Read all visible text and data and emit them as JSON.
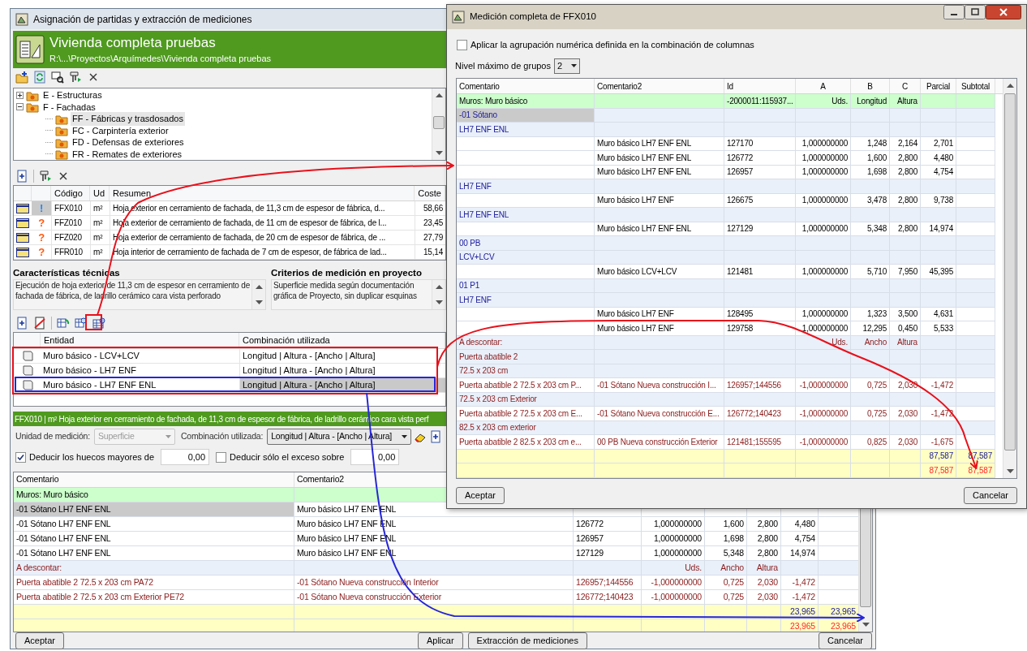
{
  "main_window": {
    "title": "Asignación de partidas y extracción de mediciones",
    "project": {
      "name": "Vivienda completa pruebas",
      "path": "R:\\...\\Proyectos\\Arquímedes\\Vivienda completa pruebas"
    },
    "tree": [
      {
        "label": "E - Estructuras",
        "expanded": false,
        "selected": false
      },
      {
        "label": "F - Fachadas",
        "expanded": true,
        "selected": false,
        "children": [
          {
            "label": "FF - Fábricas y trasdosados",
            "selected": true
          },
          {
            "label": "FC - Carpintería exterior",
            "selected": false
          },
          {
            "label": "FD - Defensas de exteriores",
            "selected": false
          },
          {
            "label": "FR - Remates de exteriores",
            "selected": false
          }
        ]
      }
    ],
    "items_table": {
      "columns": [
        "Código",
        "Ud",
        "Resumen",
        "Coste"
      ],
      "rows": [
        {
          "kind": "info",
          "mark": "!",
          "code": "FFX010",
          "unit": "m²",
          "summary": "Hoja exterior en cerramiento de fachada, de 11,3 cm de espesor de fábrica, d...",
          "cost": "58,66",
          "selected": true
        },
        {
          "kind": "unknown",
          "mark": "?",
          "code": "FFZ010",
          "unit": "m²",
          "summary": "Hoja exterior de cerramiento de fachada, de 11 cm de espesor de fábrica, de l...",
          "cost": "23,45",
          "selected": false
        },
        {
          "kind": "unknown",
          "mark": "?",
          "code": "FFZ020",
          "unit": "m²",
          "summary": "Hoja exterior de cerramiento de fachada, de 20 cm de espesor de fábrica, de ...",
          "cost": "27,79",
          "selected": false
        },
        {
          "kind": "unknown",
          "mark": "?",
          "code": "FFR010",
          "unit": "m²",
          "summary": "Hoja interior de cerramiento de fachada de 7 cm de espesor, de fábrica de lad...",
          "cost": "15,14",
          "selected": false
        }
      ]
    },
    "characteristics": {
      "title": "Características técnicas",
      "text": "Ejecución de hoja exterior de 11,3 cm de espesor en cerramiento de fachada de fábrica, de ladrillo cerámico cara vista perforado"
    },
    "criteria": {
      "title": "Criterios de medición en proyecto",
      "text": "Superficie medida según documentación gráfica de Proyecto, sin duplicar esquinas"
    },
    "entities_table": {
      "columns": [
        "Entidad",
        "Combinación utilizada"
      ],
      "rows": [
        {
          "entity": "Muro básico - LCV+LCV",
          "combination": "Longitud | Altura - [Ancho | Altura]",
          "selected": false
        },
        {
          "entity": "Muro básico - LH7 ENF",
          "combination": "Longitud | Altura - [Ancho | Altura]",
          "selected": false
        },
        {
          "entity": "Muro básico - LH7 ENF ENL",
          "combination": "Longitud | Altura - [Ancho | Altura]",
          "selected": true
        }
      ]
    },
    "item_bar": "FFX010 | m² Hoja exterior en cerramiento de fachada, de 11,3 cm de espesor de fábrica, de ladrillo cerámico cara vista perf",
    "unit": {
      "label": "Unidad de medición:",
      "value": "Superficie",
      "disabled": true
    },
    "combination": {
      "label": "Combinación utilizada:",
      "value": "Longitud | Altura - [Ancho | Altura]"
    },
    "deductions": [
      {
        "label": "Deducir los huecos mayores de",
        "checked": true,
        "value": "0,00"
      },
      {
        "label": "Deducir sólo el exceso sobre",
        "checked": false,
        "value": "0,00"
      }
    ],
    "measure_table": {
      "columns": [
        "Comentario",
        "Comentario2"
      ],
      "rows": [
        {
          "kind": "header",
          "selected": false,
          "comentario": "Muros: Muro básico"
        },
        {
          "kind": "item",
          "selected": true,
          "comentario": "-01 Sótano LH7 ENF ENL",
          "comentario2": "Muro básico LH7 ENF ENL"
        },
        {
          "kind": "item",
          "selected": false,
          "comentario": "-01 Sótano LH7 ENF ENL",
          "comentario2": "Muro básico LH7 ENF ENL",
          "id": "126772",
          "a": "1,000000000",
          "b": "1,600",
          "c": "2,800",
          "parcial": "4,480"
        },
        {
          "kind": "item",
          "selected": false,
          "comentario": "-01 Sótano LH7 ENF ENL",
          "comentario2": "Muro básico LH7 ENF ENL",
          "id": "126957",
          "a": "1,000000000",
          "b": "1,698",
          "c": "2,800",
          "parcial": "4,754"
        },
        {
          "kind": "item",
          "selected": false,
          "comentario": "-01 Sótano LH7 ENF ENL",
          "comentario2": "Muro básico LH7 ENF ENL",
          "id": "127129",
          "a": "1,000000000",
          "b": "5,348",
          "c": "2,800",
          "parcial": "14,974"
        },
        {
          "kind": "deduct-header",
          "selected": false,
          "comentario": "A descontar:",
          "a": "Uds.",
          "b": "Ancho",
          "c": "Altura"
        },
        {
          "kind": "deduct-item",
          "selected": false,
          "comentario": "Puerta abatible 2 72.5 x 203 cm PA72",
          "comentario2": "-01 Sótano Nueva construcción Interior",
          "id": "126957;144556",
          "a": "-1,000000000",
          "b": "0,725",
          "c": "2,030",
          "parcial": "-1,472"
        },
        {
          "kind": "deduct-item",
          "selected": false,
          "comentario": "Puerta abatible 2 72.5 x 203 cm Exterior PE72",
          "comentario2": "-01 Sótano Nueva construcción Exterior",
          "id": "126772;140423",
          "a": "-1,000000000",
          "b": "0,725",
          "c": "2,030",
          "parcial": "-1,472"
        },
        {
          "kind": "total",
          "selected": false,
          "parcial": "23,965",
          "subtotal": "23,965"
        },
        {
          "kind": "total-final",
          "selected": false,
          "parcial": "23,965",
          "subtotal": "23,965"
        }
      ]
    },
    "buttons": [
      "Aceptar",
      "Aplicar",
      "Extracción de mediciones",
      "Cancelar"
    ]
  },
  "dialog": {
    "title": "Medición completa de FFX010",
    "apply_grouping": {
      "label": "Aplicar la agrupación numérica definida en la combinación de columnas",
      "checked": false
    },
    "max_level": {
      "label": "Nivel máximo de grupos",
      "value": "2"
    },
    "table": {
      "columns": [
        "Comentario",
        "Comentario2",
        "Id",
        "A",
        "B",
        "C",
        "Parcial",
        "Subtotal"
      ],
      "rows": [
        {
          "kind": "header",
          "selected": false,
          "comentario": "Muros: Muro básico",
          "id": "-2000011:115937...",
          "a": "Uds.",
          "b": "Longitud",
          "c": "Altura"
        },
        {
          "kind": "group",
          "selected": true,
          "comentario": "-01 Sótano"
        },
        {
          "kind": "group",
          "selected": false,
          "comentario": "LH7 ENF ENL"
        },
        {
          "kind": "item",
          "selected": false,
          "comentario2": "Muro básico LH7 ENF ENL",
          "id": "127170",
          "a": "1,000000000",
          "b": "1,248",
          "c": "2,164",
          "parcial": "2,701"
        },
        {
          "kind": "item",
          "selected": false,
          "comentario2": "Muro básico LH7 ENF ENL",
          "id": "126772",
          "a": "1,000000000",
          "b": "1,600",
          "c": "2,800",
          "parcial": "4,480"
        },
        {
          "kind": "item",
          "selected": false,
          "comentario2": "Muro básico LH7 ENF ENL",
          "id": "126957",
          "a": "1,000000000",
          "b": "1,698",
          "c": "2,800",
          "parcial": "4,754"
        },
        {
          "kind": "group",
          "selected": false,
          "comentario": "LH7 ENF"
        },
        {
          "kind": "item",
          "selected": false,
          "comentario2": "Muro básico LH7 ENF",
          "id": "126675",
          "a": "1,000000000",
          "b": "3,478",
          "c": "2,800",
          "parcial": "9,738"
        },
        {
          "kind": "group",
          "selected": false,
          "comentario": "LH7 ENF ENL"
        },
        {
          "kind": "item",
          "selected": false,
          "comentario2": "Muro básico LH7 ENF ENL",
          "id": "127129",
          "a": "1,000000000",
          "b": "5,348",
          "c": "2,800",
          "parcial": "14,974"
        },
        {
          "kind": "group",
          "selected": false,
          "comentario": "00 PB"
        },
        {
          "kind": "group",
          "selected": false,
          "comentario": "LCV+LCV"
        },
        {
          "kind": "item",
          "selected": false,
          "comentario2": "Muro básico LCV+LCV",
          "id": "121481",
          "a": "1,000000000",
          "b": "5,710",
          "c": "7,950",
          "parcial": "45,395"
        },
        {
          "kind": "group",
          "selected": false,
          "comentario": "01 P1"
        },
        {
          "kind": "group",
          "selected": false,
          "comentario": "LH7 ENF"
        },
        {
          "kind": "item",
          "selected": false,
          "comentario2": "Muro básico LH7 ENF",
          "id": "128495",
          "a": "1,000000000",
          "b": "1,323",
          "c": "3,500",
          "parcial": "4,631"
        },
        {
          "kind": "item",
          "selected": false,
          "comentario2": "Muro básico LH7 ENF",
          "id": "129758",
          "a": "1,000000000",
          "b": "12,295",
          "c": "0,450",
          "parcial": "5,533"
        },
        {
          "kind": "deduct-header",
          "selected": false,
          "comentario": "A descontar:",
          "a": "Uds.",
          "b": "Ancho",
          "c": "Altura"
        },
        {
          "kind": "deduct-group",
          "selected": false,
          "comentario": "Puerta abatible 2"
        },
        {
          "kind": "deduct-group",
          "selected": false,
          "comentario": "72.5 x 203 cm"
        },
        {
          "kind": "deduct-item",
          "selected": false,
          "comentario": "Puerta abatible 2 72.5 x 203 cm P...",
          "comentario2": "-01 Sótano Nueva construcción I...",
          "id": "126957;144556",
          "a": "-1,000000000",
          "b": "0,725",
          "c": "2,030",
          "parcial": "-1,472"
        },
        {
          "kind": "deduct-group",
          "selected": false,
          "comentario": "72.5 x 203 cm Exterior"
        },
        {
          "kind": "deduct-item",
          "selected": false,
          "comentario": "Puerta abatible 2 72.5 x 203 cm E...",
          "comentario2": "-01 Sótano Nueva construcción E...",
          "id": "126772;140423",
          "a": "-1,000000000",
          "b": "0,725",
          "c": "2,030",
          "parcial": "-1,472"
        },
        {
          "kind": "deduct-group",
          "selected": false,
          "comentario": "82.5 x 203 cm exterior"
        },
        {
          "kind": "deduct-item",
          "selected": false,
          "comentario": "Puerta abatible 2 82.5 x 203 cm e...",
          "comentario2": "00 PB Nueva construcción Exterior",
          "id": "121481;155595",
          "a": "-1,000000000",
          "b": "0,825",
          "c": "2,030",
          "parcial": "-1,675"
        },
        {
          "kind": "total",
          "selected": false,
          "parcial": "87,587",
          "subtotal": "87,587"
        },
        {
          "kind": "total-final",
          "selected": false,
          "parcial": "87,587",
          "subtotal": "87,587"
        }
      ]
    },
    "buttons": [
      "Aceptar",
      "Cancelar"
    ]
  }
}
